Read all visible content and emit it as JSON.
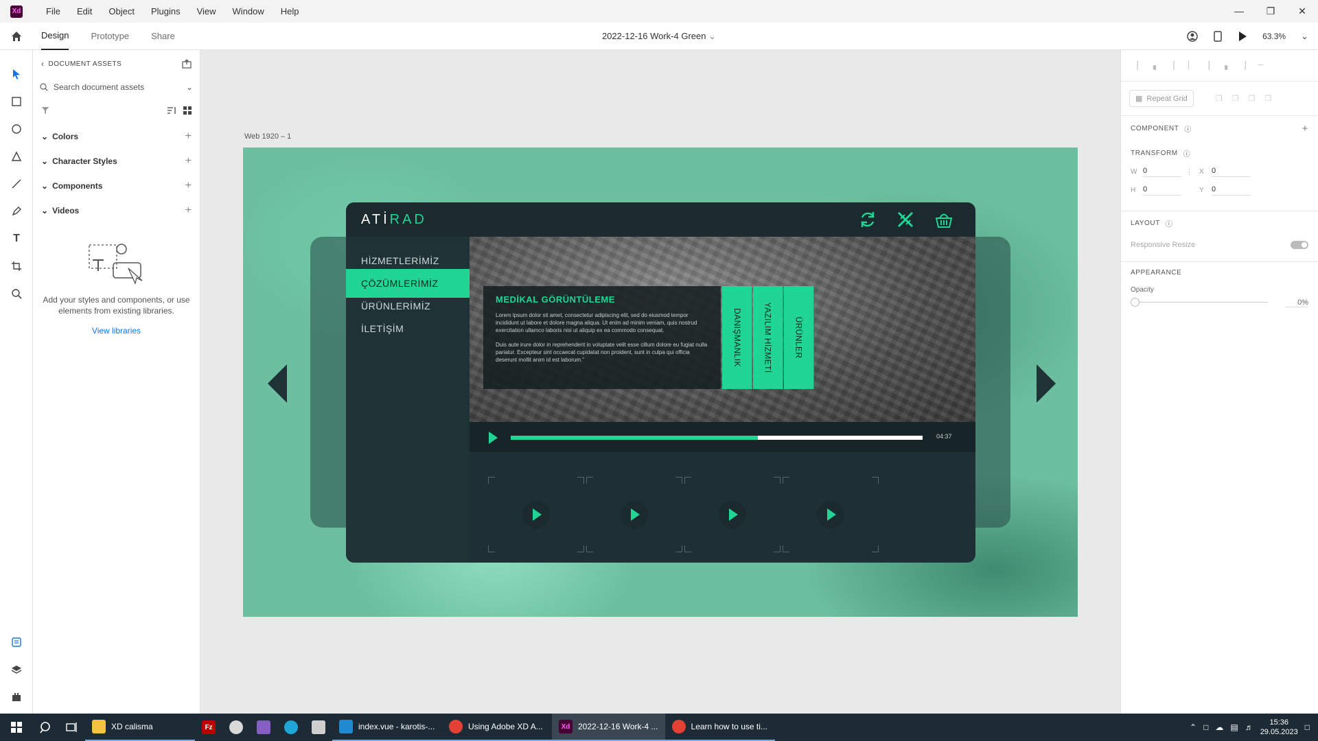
{
  "titlebar": {
    "menu": [
      "File",
      "Edit",
      "Object",
      "Plugins",
      "View",
      "Window",
      "Help"
    ],
    "logo_text": "Xd"
  },
  "toolbar": {
    "tabs": [
      "Design",
      "Prototype",
      "Share"
    ],
    "doc_title": "2022-12-16 Work-4 Green",
    "zoom": "63.3%"
  },
  "assets": {
    "header": "DOCUMENT ASSETS",
    "search_placeholder": "Search document assets",
    "sections": [
      "Colors",
      "Character Styles",
      "Components",
      "Videos"
    ],
    "empty_text": "Add your styles and components, or use elements from existing libraries.",
    "view_libraries": "View libraries"
  },
  "props": {
    "repeat_grid": "Repeat Grid",
    "component": "COMPONENT",
    "transform": "TRANSFORM",
    "w_label": "W",
    "w": "0",
    "x_label": "X",
    "x": "0",
    "h_label": "H",
    "h": "0",
    "y_label": "Y",
    "y": "0",
    "layout": "LAYOUT",
    "responsive_resize": "Responsive Resize",
    "appearance": "APPEARANCE",
    "opacity_label": "Opacity",
    "opacity": "0%"
  },
  "canvas": {
    "artboard_label": "Web 1920 – 1",
    "brand_a": "ATİ",
    "brand_b": "RAD",
    "nav": [
      "HİZMETLERİMİZ",
      "ÇÖZÜMLERİMİZ",
      "ÜRÜNLERİMİZ",
      "İLETİŞİM"
    ],
    "active_nav": 1,
    "info_title": "MEDİKAL GÖRÜNTÜLEME",
    "info_p1": "Lorem ipsum dolor sit amet, consectetur adipiscing elit, sed do eiusmod tempor incididunt ut labore et dolore magna aliqua. Ut enim ad minim veniam, quis nostrud exercitation ullamco laboris nisi ut aliquip ex ea commodo consequat.",
    "info_p2": "Duis aute irure dolor in reprehenderit in voluptate velit esse cillum dolore eu fugiat nulla pariatur. Excepteur sint occaecat cupidatat non proident, sunt in culpa qui officia deserunt mollit anim id est laborum.\"",
    "vtabs": [
      "DANIŞMANLIK",
      "YAZILIM HİZMETİ",
      "ÜRÜNLER"
    ],
    "time": "04:37",
    "progress": 0.6,
    "accent": "#21d695"
  },
  "taskbar": {
    "apps": [
      {
        "label": "XD calisma",
        "icon": "folder-icon"
      },
      {
        "label": "index.vue - karotis-...",
        "icon": "vscode-icon"
      },
      {
        "label": "Using Adobe XD A...",
        "icon": "chrome-icon"
      },
      {
        "label": "2022-12-16 Work-4 ...",
        "icon": "xd-icon"
      },
      {
        "label": "Learn how to use ti...",
        "icon": "chrome-icon"
      }
    ],
    "time": "15:36",
    "date": "29.05.2023"
  }
}
